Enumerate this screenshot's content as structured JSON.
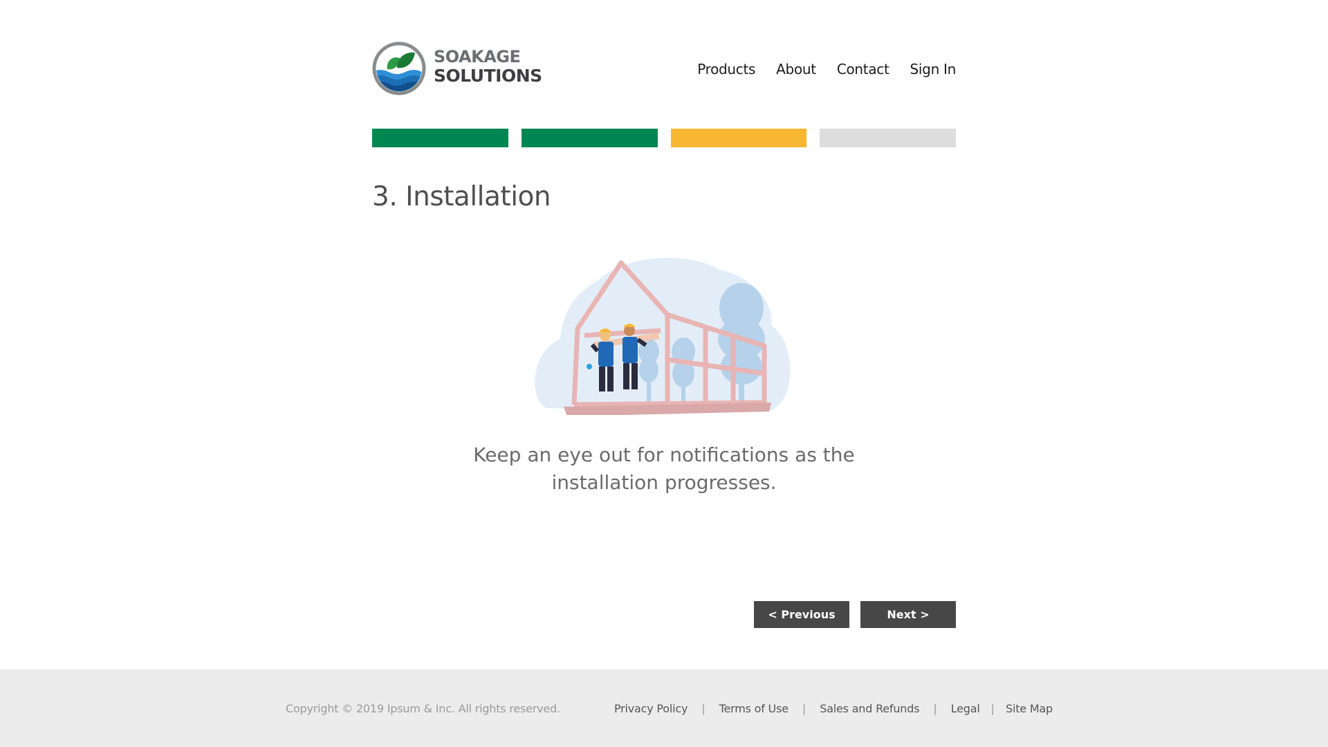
{
  "brand": {
    "line1": "SOAKAGE",
    "line2": "SOLUTIONS",
    "colors": {
      "gray": "#6d6e71",
      "dark": "#3f3f41",
      "leaf": "#1f8a3c",
      "water": "#1c6fb5"
    }
  },
  "nav": {
    "items": [
      {
        "label": "Products"
      },
      {
        "label": "About"
      },
      {
        "label": "Contact"
      },
      {
        "label": "Sign In"
      }
    ]
  },
  "progress": {
    "current_step": 3,
    "total_steps": 4,
    "segments": [
      {
        "status": "complete",
        "color": "#008751"
      },
      {
        "status": "complete",
        "color": "#008751"
      },
      {
        "status": "current",
        "color": "#f7b733"
      },
      {
        "status": "pending",
        "color": "#dddddd"
      }
    ]
  },
  "step": {
    "title": "3. Installation",
    "message": "Keep an eye out for notifications as the installation progresses.",
    "illustration": "construction-workers-house-frame"
  },
  "buttons": {
    "previous_label": "< Previous",
    "next_label": "Next >"
  },
  "footer": {
    "copyright": "Copyright © 2019 Ipsum & Inc. All rights reserved.",
    "separator": "|",
    "links": [
      {
        "label": "Privacy Policy"
      },
      {
        "label": "Terms of Use"
      },
      {
        "label": "Sales and Refunds"
      },
      {
        "label": "Legal"
      },
      {
        "label": "Site Map"
      }
    ]
  }
}
